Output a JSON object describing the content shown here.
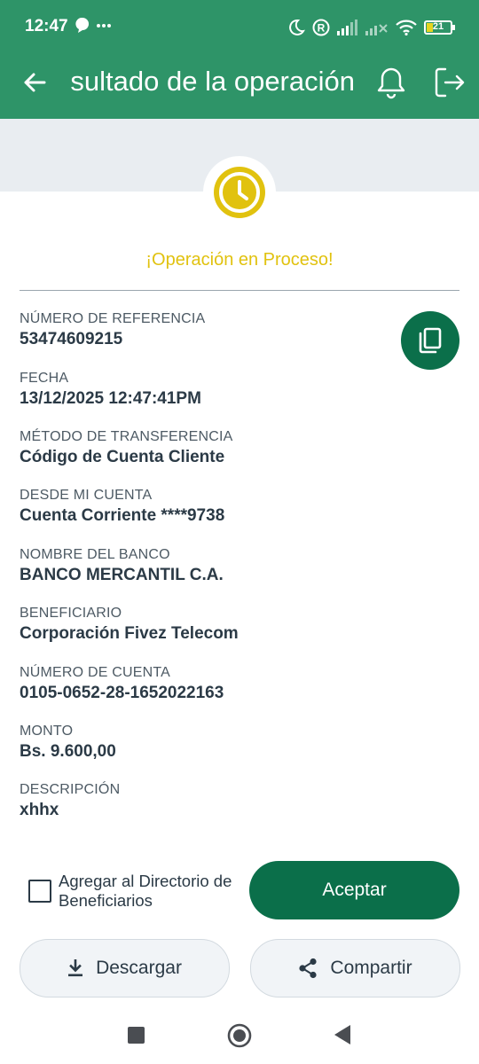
{
  "status_bar": {
    "time": "12:47",
    "battery": "21",
    "icons": [
      "chat-bubble-icon",
      "more-dots-icon",
      "moon-icon",
      "registered-icon",
      "signal-icon",
      "signal-x-icon",
      "wifi-icon",
      "battery-icon"
    ]
  },
  "header": {
    "title": "Resultado de la operación",
    "icons": [
      "back-arrow-icon",
      "bell-icon",
      "logout-icon"
    ]
  },
  "result": {
    "status_icon": "clock-icon",
    "message": "¡Operación en Proceso!"
  },
  "fields": [
    {
      "label": "NÚMERO DE REFERENCIA",
      "value": "53474609215"
    },
    {
      "label": "FECHA",
      "value": "13/12/2025 12:47:41PM"
    },
    {
      "label": "MÉTODO DE TRANSFERENCIA",
      "value": "Código de Cuenta Cliente"
    },
    {
      "label": "DESDE MI CUENTA",
      "value": "Cuenta Corriente ****9738"
    },
    {
      "label": "NOMBRE DEL BANCO",
      "value": "BANCO MERCANTIL C.A."
    },
    {
      "label": "BENEFICIARIO",
      "value": "Corporación Fivez Telecom"
    },
    {
      "label": "NÚMERO DE CUENTA",
      "value": "0105-0652-28-1652022163"
    },
    {
      "label": "MONTO",
      "value": "Bs. 9.600,00"
    },
    {
      "label": "DESCRIPCIÓN",
      "value": "xhhx"
    }
  ],
  "actions": {
    "add_directory_label": "Agregar al Directorio de Beneficiarios",
    "add_directory_checked": false,
    "accept": "Aceptar",
    "download": "Descargar",
    "share": "Compartir"
  },
  "colors": {
    "header_green": "#2e9468",
    "primary_green": "#0b6f4a",
    "pending_yellow": "#e1c20f"
  }
}
